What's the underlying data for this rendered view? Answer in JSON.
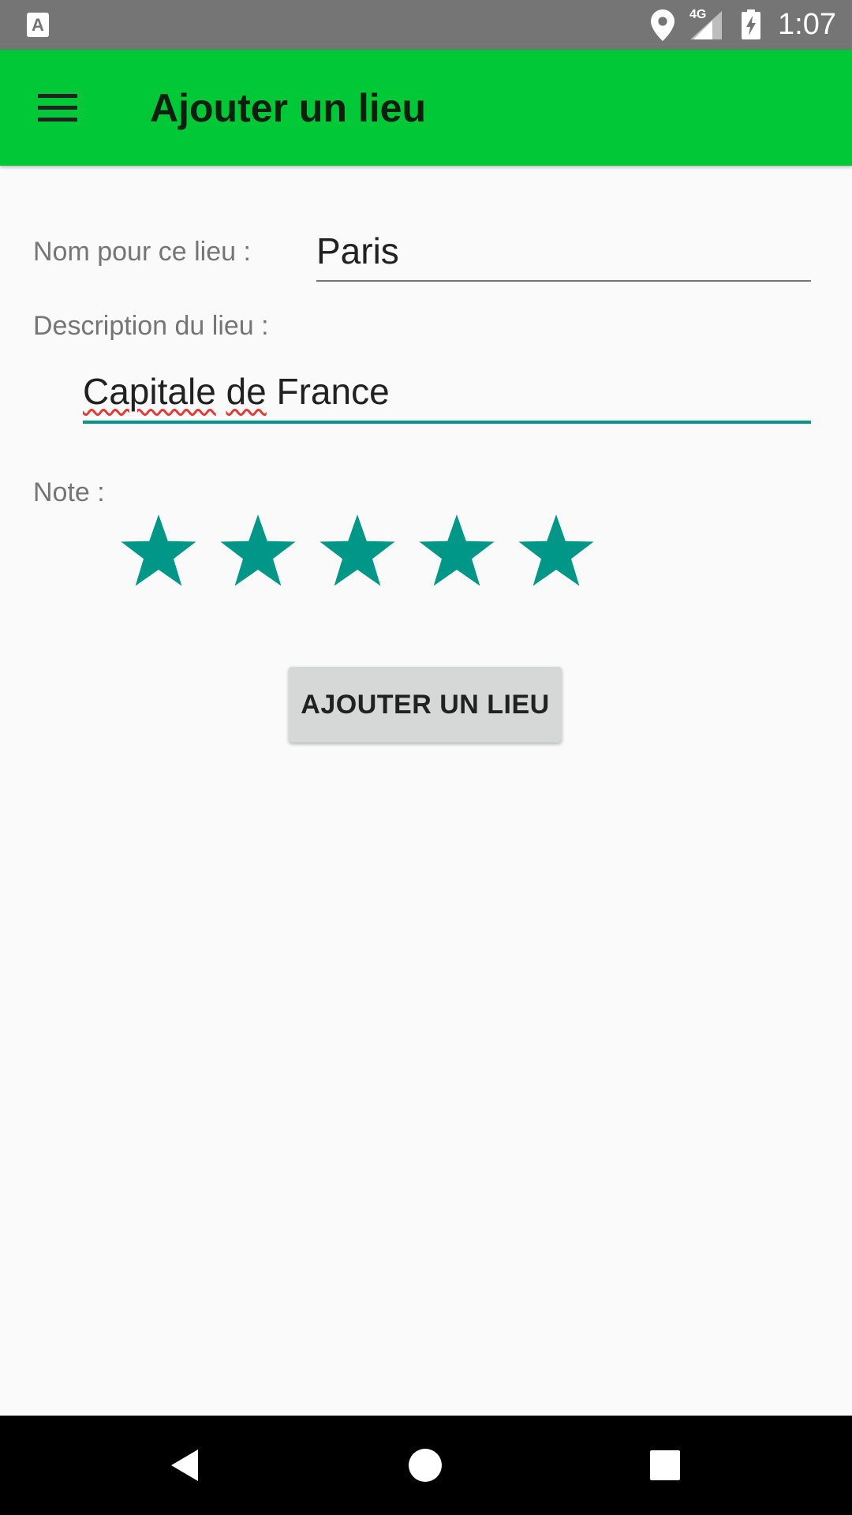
{
  "status_bar": {
    "app_icon_letter": "A",
    "network_label": "4G",
    "time": "1:07",
    "icons": [
      "app-notification-icon",
      "location-icon",
      "signal-icon",
      "battery-charging-icon"
    ]
  },
  "toolbar": {
    "title": "Ajouter un lieu",
    "menu_icon": "hamburger-menu-icon",
    "background_color": "#00c837"
  },
  "form": {
    "name_label": "Nom pour ce lieu :",
    "name_value": "Paris",
    "description_label": "Description du lieu :",
    "description_words": [
      "Capitale",
      "de",
      "France"
    ],
    "rating_label": "Note :",
    "rating": 5,
    "rating_max": 5,
    "accent_color": "#009688",
    "submit_label": "AJOUTER UN LIEU"
  },
  "nav_bar": {
    "buttons": [
      "back-icon",
      "home-icon",
      "recents-icon"
    ]
  }
}
